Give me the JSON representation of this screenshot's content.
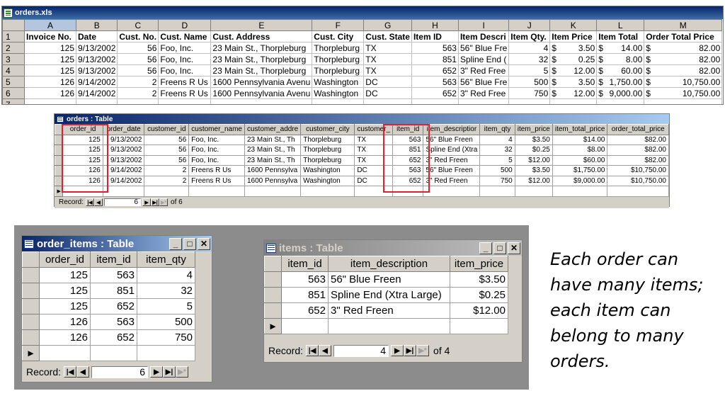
{
  "excel": {
    "title": "orders.xls",
    "col_letters": [
      "A",
      "B",
      "C",
      "D",
      "E",
      "F",
      "G",
      "H",
      "I",
      "J",
      "K",
      "L",
      "M"
    ],
    "row_numbers": [
      "1",
      "2",
      "3",
      "4",
      "5",
      "6",
      "7"
    ],
    "headers": [
      "Invoice No.",
      "Date",
      "Cust. No.",
      "Cust. Name",
      "Cust. Address",
      "Cust. City",
      "Cust. State",
      "Item ID",
      "Item Descri",
      "Item Qty.",
      "Item Price",
      "Item Total",
      "Order Total Price"
    ],
    "rows": [
      [
        "125",
        "9/13/2002",
        "56",
        "Foo, Inc.",
        "23 Main St., Thorpleburg",
        "Thorpleburg",
        "TX",
        "563",
        "56\" Blue Fre",
        "4",
        "$",
        "3.50",
        "$",
        "14.00",
        "$",
        "82.00"
      ],
      [
        "125",
        "9/13/2002",
        "56",
        "Foo, Inc.",
        "23 Main St., Thorpleburg",
        "Thorpleburg",
        "TX",
        "851",
        "Spline End (",
        "32",
        "$",
        "0.25",
        "$",
        "8.00",
        "$",
        "82.00"
      ],
      [
        "125",
        "9/13/2002",
        "56",
        "Foo, Inc.",
        "23 Main St., Thorpleburg",
        "Thorpleburg",
        "TX",
        "652",
        "3\" Red Free",
        "5",
        "$",
        "12.00",
        "$",
        "60.00",
        "$",
        "82.00"
      ],
      [
        "126",
        "9/14/2002",
        "2",
        "Freens R Us",
        "1600 Pennsylvania Avenu",
        "Washington",
        "DC",
        "563",
        "56\" Blue Fre",
        "500",
        "$",
        "3.50",
        "$",
        "1,750.00",
        "$",
        "10,750.00"
      ],
      [
        "126",
        "9/14/2002",
        "2",
        "Freens R Us",
        "1600 Pennsylvania Avenu",
        "Washington",
        "DC",
        "652",
        "3\" Red Free",
        "750",
        "$",
        "12.00",
        "$",
        "9,000.00",
        "$",
        "10,750.00"
      ]
    ]
  },
  "orders_table": {
    "title": "orders : Table",
    "headers": [
      "order_id",
      "order_date",
      "customer_id",
      "customer_name",
      "customer_addre",
      "customer_city",
      "customer_",
      "item_id",
      "item_descriptior",
      "item_qty",
      "item_price",
      "item_total_price",
      "order_total_price"
    ],
    "rows": [
      [
        "125",
        "9/13/2002",
        "56",
        "Foo, Inc.",
        "23 Main St., Th",
        "Thorpleburg",
        "TX",
        "563",
        "56\" Blue Freen",
        "4",
        "$3.50",
        "$14.00",
        "$82.00"
      ],
      [
        "125",
        "9/13/2002",
        "56",
        "Foo, Inc.",
        "23 Main St., Th",
        "Thorpleburg",
        "TX",
        "851",
        "Spline End (Xtra",
        "32",
        "$0.25",
        "$8.00",
        "$82.00"
      ],
      [
        "125",
        "9/13/2002",
        "56",
        "Foo, Inc.",
        "23 Main St., Th",
        "Thorpleburg",
        "TX",
        "652",
        "3\" Red Freen",
        "5",
        "$12.00",
        "$60.00",
        "$82.00"
      ],
      [
        "126",
        "9/14/2002",
        "2",
        "Freens R Us",
        "1600 Pennsylva",
        "Washington",
        "DC",
        "563",
        "56\" Blue Freen",
        "500",
        "$3.50",
        "$1,750.00",
        "$10,750.00"
      ],
      [
        "126",
        "9/14/2002",
        "2",
        "Freens R Us",
        "1600 Pennsylva",
        "Washington",
        "DC",
        "652",
        "3\" Red Freen",
        "750",
        "$12.00",
        "$9,000.00",
        "$10,750.00"
      ]
    ],
    "record_label": "Record:",
    "record_value": "6",
    "of_label": "of 6"
  },
  "order_items_table": {
    "title": "order_items : Table",
    "headers": [
      "order_id",
      "item_id",
      "item_qty"
    ],
    "rows": [
      [
        "125",
        "563",
        "4"
      ],
      [
        "125",
        "851",
        "32"
      ],
      [
        "125",
        "652",
        "5"
      ],
      [
        "126",
        "563",
        "500"
      ],
      [
        "126",
        "652",
        "750"
      ]
    ],
    "record_label": "Record:",
    "record_value": "6"
  },
  "items_table": {
    "title": "items : Table",
    "headers": [
      "item_id",
      "item_description",
      "item_price"
    ],
    "rows": [
      [
        "563",
        "56\" Blue Freen",
        "$3.50"
      ],
      [
        "851",
        "Spline End (Xtra Large)",
        "$0.25"
      ],
      [
        "652",
        "3\" Red Freen",
        "$12.00"
      ]
    ],
    "record_label": "Record:",
    "record_value": "4",
    "of_label": "of 4"
  },
  "caption": "Each order can have many items; each item can belong to many orders.",
  "colors": {
    "highlight_box": "#e0202a",
    "titlebar_active": "#0a246a",
    "window_face": "#d4d0c8"
  },
  "icons": [
    "excel-file-icon",
    "table-icon",
    "minimize-icon",
    "maximize-icon",
    "close-icon",
    "first-record-icon",
    "prev-record-icon",
    "next-record-icon",
    "last-record-icon",
    "new-record-icon",
    "current-record-arrow-icon"
  ]
}
